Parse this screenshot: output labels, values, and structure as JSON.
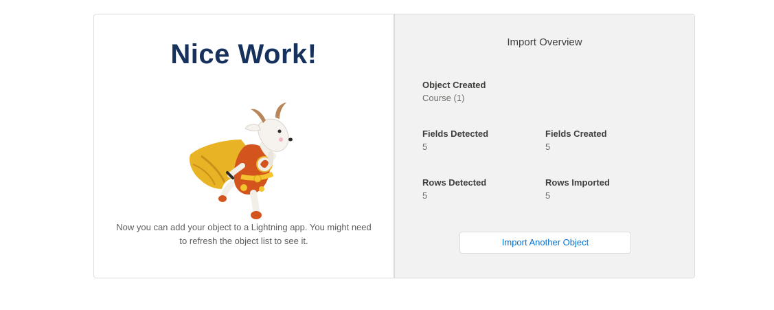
{
  "success_panel": {
    "headline": "Nice Work!",
    "mascot": "goat-superhero-mascot-illustration",
    "note": "Now you can add your object to a Lightning app. You might need to refresh the object list to see it."
  },
  "overview": {
    "title": "Import Overview",
    "object_created": {
      "label": "Object Created",
      "value": "Course (1)"
    },
    "fields_detected": {
      "label": "Fields Detected",
      "value": "5"
    },
    "fields_created": {
      "label": "Fields Created",
      "value": "5"
    },
    "rows_detected": {
      "label": "Rows Detected",
      "value": "5"
    },
    "rows_imported": {
      "label": "Rows Imported",
      "value": "5"
    },
    "import_another_label": "Import Another Object"
  },
  "colors": {
    "headline": "#16325c",
    "link_blue": "#0070d2",
    "panel_gray": "#f3f2f2",
    "cape_gold": "#e8b325",
    "suit_orange": "#d4541d"
  }
}
